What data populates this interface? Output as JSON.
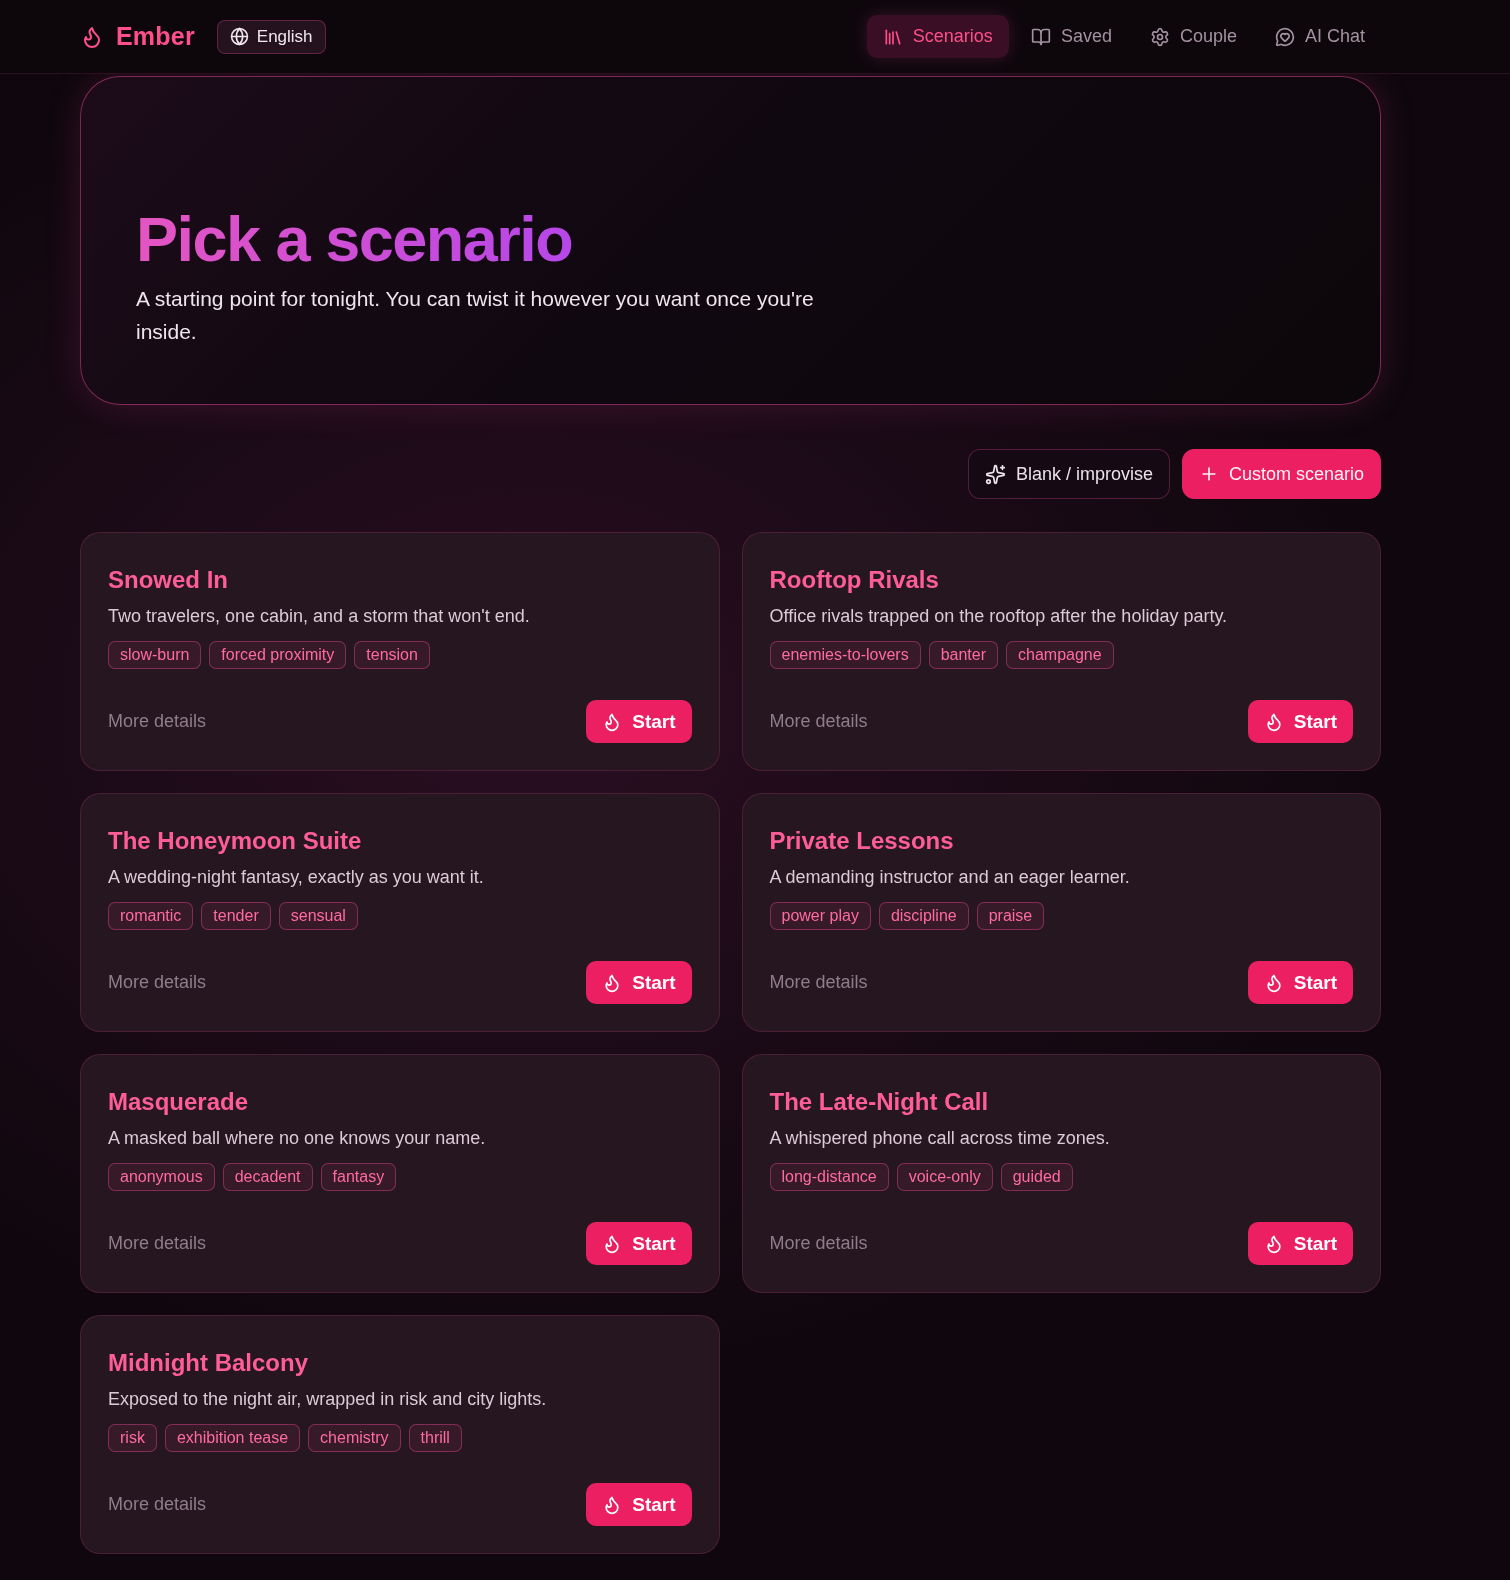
{
  "brand": {
    "name": "Ember"
  },
  "language": {
    "label": "English"
  },
  "nav": [
    {
      "label": "Scenarios",
      "selected": true
    },
    {
      "label": "Saved",
      "selected": false
    },
    {
      "label": "Couple",
      "selected": false
    },
    {
      "label": "AI Chat",
      "selected": false
    }
  ],
  "hero": {
    "title": "Pick a scenario",
    "subtitle": "A starting point for tonight. You can twist it however you want once you're inside."
  },
  "actions": [
    {
      "label": "Blank / improvise",
      "kind": "outline"
    },
    {
      "label": "Custom scenario",
      "kind": "filled"
    }
  ],
  "scenarios": [
    {
      "title": "Snowed In",
      "description": "Two travelers, one cabin, and a storm that won't end.",
      "tags": [
        "slow-burn",
        "forced proximity",
        "tension"
      ],
      "details": "More details",
      "start": "Start"
    },
    {
      "title": "Rooftop Rivals",
      "description": "Office rivals trapped on the rooftop after the holiday party.",
      "tags": [
        "enemies-to-lovers",
        "banter",
        "champagne"
      ],
      "details": "More details",
      "start": "Start"
    },
    {
      "title": "The Honeymoon Suite",
      "description": "A wedding-night fantasy, exactly as you want it.",
      "tags": [
        "romantic",
        "tender",
        "sensual"
      ],
      "details": "More details",
      "start": "Start"
    },
    {
      "title": "Private Lessons",
      "description": "A demanding instructor and an eager learner.",
      "tags": [
        "power play",
        "discipline",
        "praise"
      ],
      "details": "More details",
      "start": "Start"
    },
    {
      "title": "Masquerade",
      "description": "A masked ball where no one knows your name.",
      "tags": [
        "anonymous",
        "decadent",
        "fantasy"
      ],
      "details": "More details",
      "start": "Start"
    },
    {
      "title": "The Late-Night Call",
      "description": "A whispered phone call across time zones.",
      "tags": [
        "long-distance",
        "voice-only",
        "guided"
      ],
      "details": "More details",
      "start": "Start"
    },
    {
      "title": "Midnight Balcony",
      "description": "Exposed to the night air, wrapped in risk and city lights.",
      "tags": [
        "risk",
        "exhibition tease",
        "chemistry",
        "thrill"
      ],
      "details": "More details",
      "start": "Start"
    }
  ]
}
